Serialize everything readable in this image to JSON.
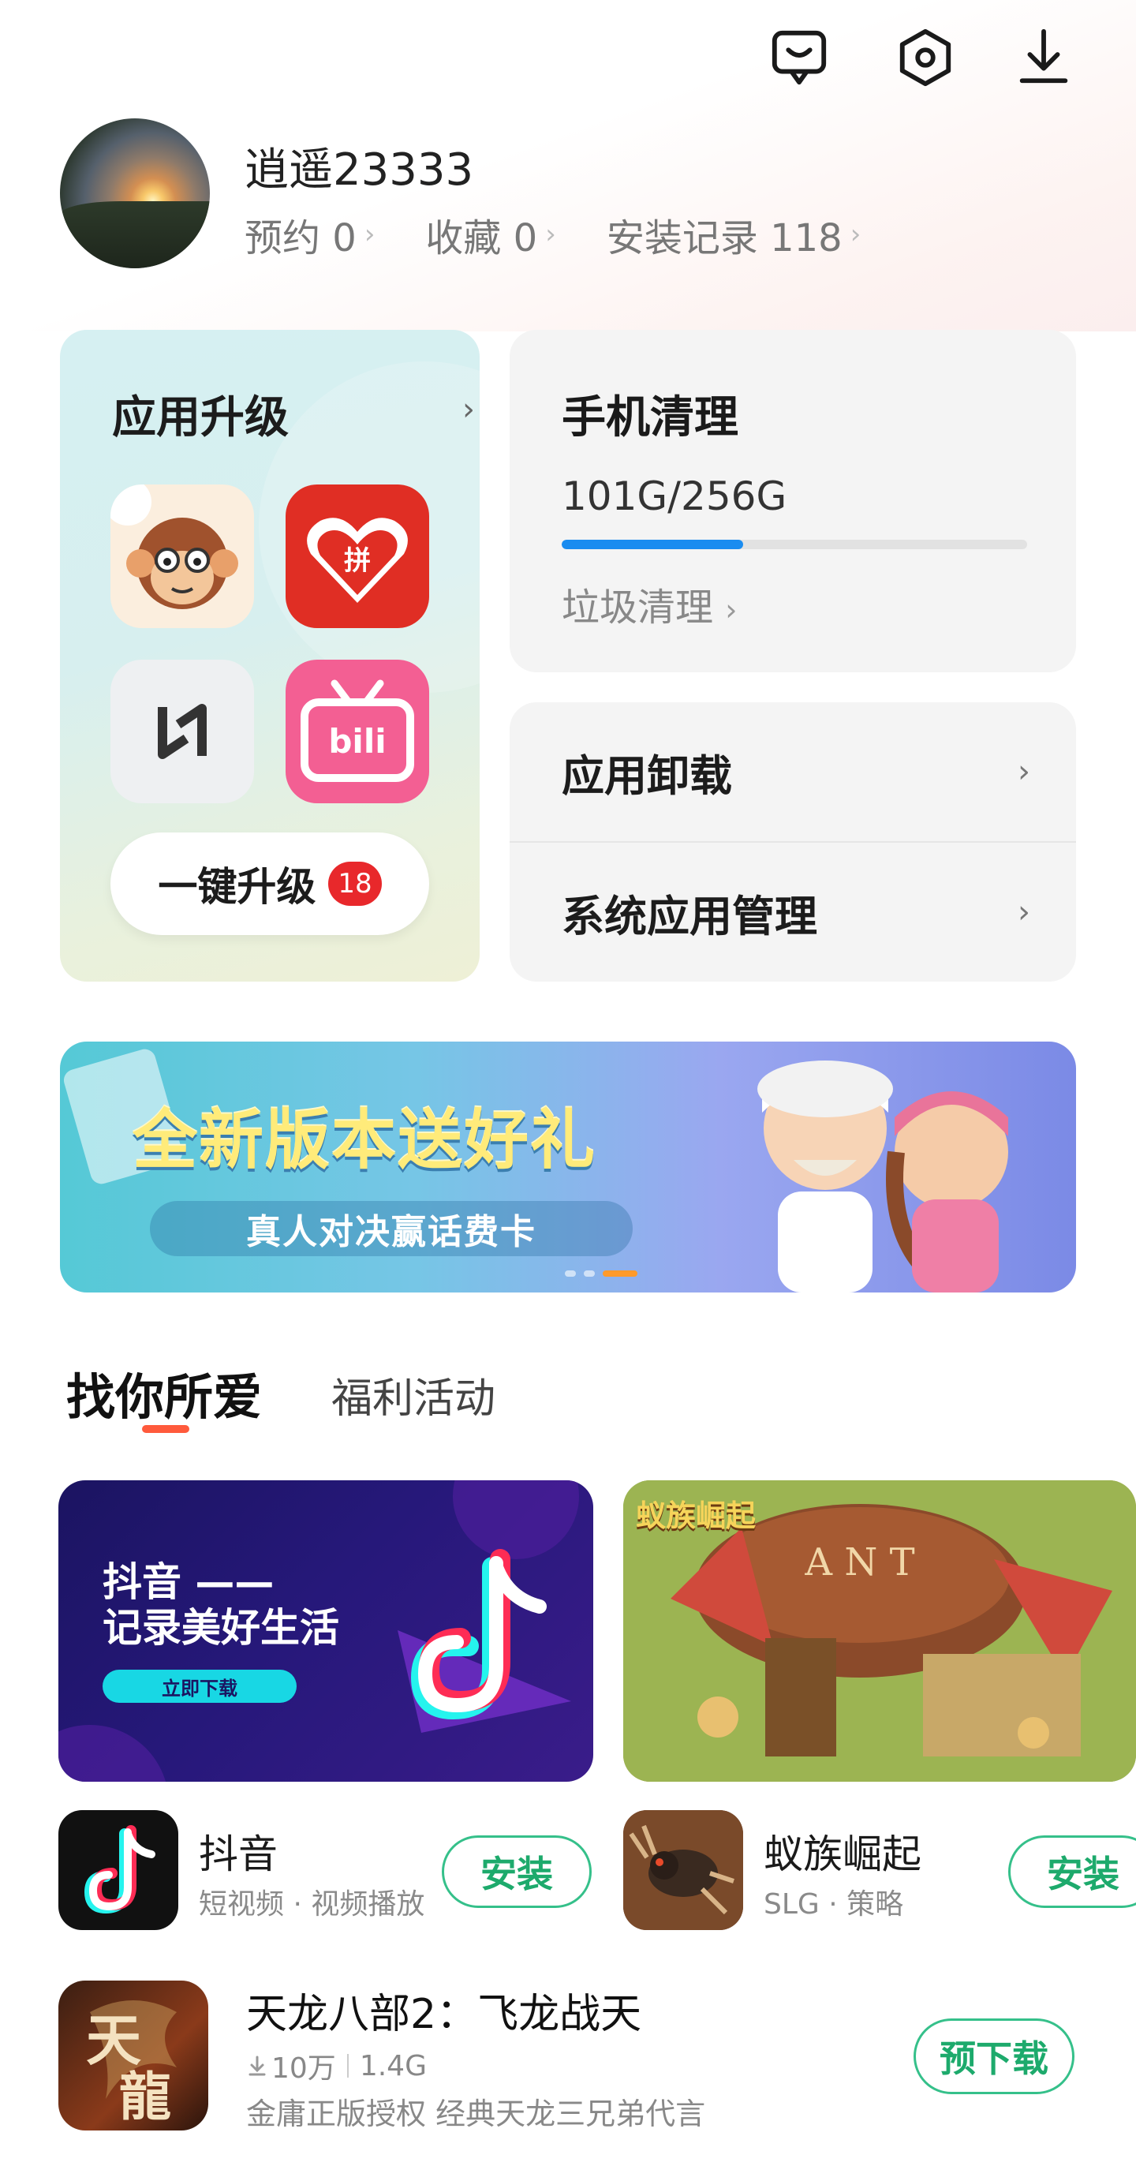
{
  "header": {
    "icons": [
      "message-icon",
      "settings-icon",
      "download-icon"
    ]
  },
  "profile": {
    "username": "逍遥23333",
    "stats": [
      {
        "label": "预约 0"
      },
      {
        "label": "收藏 0"
      },
      {
        "label": "安装记录 118"
      }
    ]
  },
  "upgrade_card": {
    "title": "应用升级",
    "apps": [
      "csdn-app-icon",
      "pinduoduo-app-icon",
      "harmony-app-icon",
      "bilibili-app-icon"
    ],
    "button_label": "一键升级",
    "badge": "18"
  },
  "clean_card": {
    "title": "手机清理",
    "storage_text": "101G/256G",
    "storage_fraction": 0.39,
    "junk_link": "垃圾清理"
  },
  "manage_card": {
    "items": [
      {
        "label": "应用卸载"
      },
      {
        "label": "系统应用管理"
      }
    ]
  },
  "banner": {
    "title": "全新版本送好礼",
    "subtitle": "真人对决赢话费卡",
    "dots": 3,
    "active_dot": 2
  },
  "tabs": {
    "active": "找你所爱",
    "inactive": "福利活动"
  },
  "features": [
    {
      "headline_1": "抖音 ——",
      "headline_2": "记录美好生活",
      "button": "立即下载"
    },
    {
      "title_art": "蚁族崛起"
    }
  ],
  "apps": [
    {
      "name": "抖音",
      "meta": "短视频 · 视频播放",
      "action": "安装"
    },
    {
      "name": "蚁族崛起",
      "meta": "SLG · 策略",
      "action": "安装"
    }
  ],
  "featured_app": {
    "name": "天龙八部2：飞龙战天",
    "downloads": "10万",
    "size": "1.4G",
    "desc": "金庸正版授权 经典天龙三兄弟代言",
    "action": "预下载"
  },
  "colors": {
    "accent_green": "#1daa6c",
    "storage_blue": "#1a8cf0",
    "tab_underline": "#ff5a3c",
    "badge_red": "#e8282b"
  }
}
